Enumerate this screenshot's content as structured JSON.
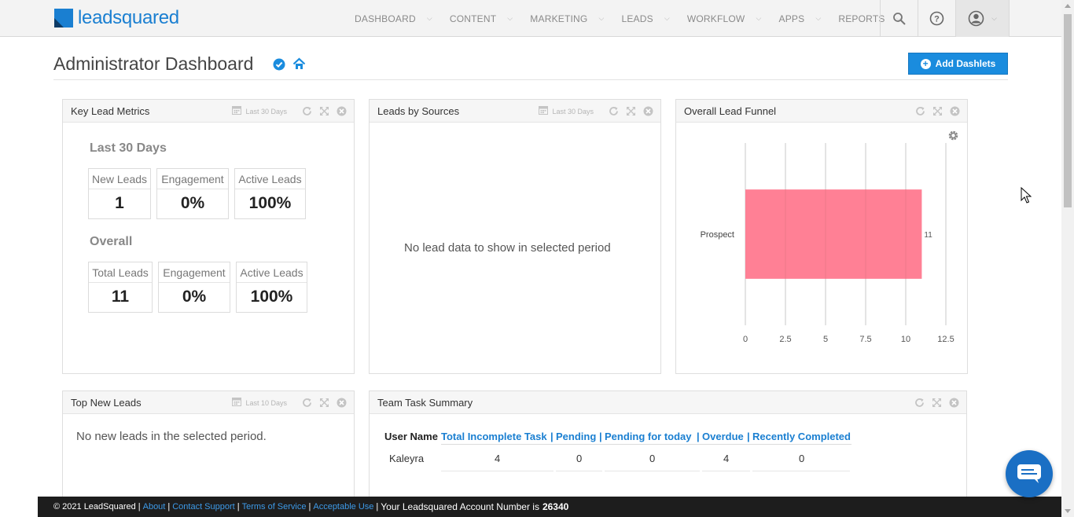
{
  "brand": {
    "logo_text": "leadsquared",
    "color": "#1a7fd1"
  },
  "nav": {
    "items": [
      "DASHBOARD",
      "CONTENT",
      "MARKETING",
      "LEADS",
      "WORKFLOW",
      "APPS",
      "REPORTS"
    ],
    "icons": [
      "search-icon",
      "help-icon",
      "profile-icon"
    ]
  },
  "header": {
    "title": "Administrator Dashboard",
    "add_button": "Add Dashlets"
  },
  "key_lead_metrics": {
    "title": "Key Lead Metrics",
    "period": "Last 30 Days",
    "recent_heading": "Last 30 Days",
    "recent": [
      {
        "label": "New Leads",
        "value": "1"
      },
      {
        "label": "Engagement",
        "value": "0%"
      },
      {
        "label": "Active Leads",
        "value": "100%"
      }
    ],
    "overall_heading": "Overall",
    "overall": [
      {
        "label": "Total Leads",
        "value": "11"
      },
      {
        "label": "Engagement",
        "value": "0%"
      },
      {
        "label": "Active Leads",
        "value": "100%"
      }
    ]
  },
  "leads_by_sources": {
    "title": "Leads by Sources",
    "period": "Last 30 Days",
    "empty_message": "No lead data to show in selected period"
  },
  "lead_funnel": {
    "title": "Overall Lead Funnel",
    "bar_color": "#ff8095"
  },
  "chart_data": {
    "type": "bar",
    "orientation": "horizontal",
    "categories": [
      "Prospect"
    ],
    "values": [
      11
    ],
    "xlim": [
      0,
      12.5
    ],
    "xticks": [
      "0",
      "2.5",
      "5",
      "7.5",
      "10",
      "12.5"
    ],
    "grid": true
  },
  "top_new_leads": {
    "title": "Top New Leads",
    "period": "Last 10 Days",
    "empty_message": "No new leads in the selected period."
  },
  "team_task_summary": {
    "title": "Team Task Summary",
    "user_header": "User Name",
    "columns": [
      "Total Incomplete Task",
      "Pending",
      "Pending for today",
      "Overdue",
      "Recently Completed"
    ],
    "rows": [
      {
        "user": "Kaleyra",
        "values": [
          "4",
          "0",
          "0",
          "4",
          "0"
        ]
      }
    ]
  },
  "footer": {
    "copyright": "© 2021 LeadSquared",
    "links": [
      "About",
      "Contact Support",
      "Terms of Service",
      "Acceptable Use"
    ],
    "account_text": "Your Leadsquared Account Number is",
    "account_number": "26340"
  }
}
